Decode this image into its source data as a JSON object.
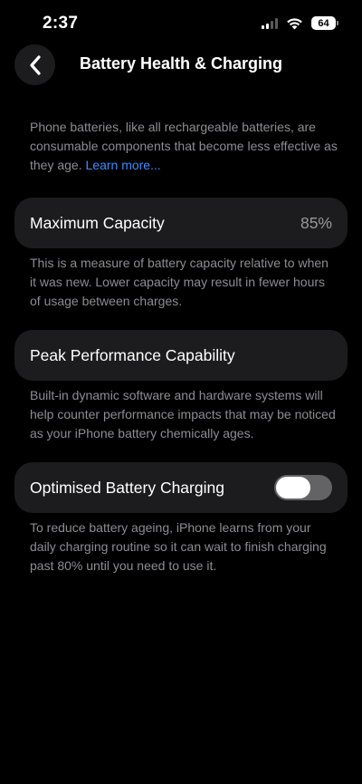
{
  "status_bar": {
    "time": "2:37",
    "battery_percent": "64",
    "signal_bars_active": 2,
    "icons": [
      "signal-icon",
      "wifi-icon",
      "battery-icon"
    ]
  },
  "header": {
    "back_icon": "chevron-left-icon",
    "title": "Battery Health & Charging"
  },
  "intro": {
    "text": "Phone batteries, like all rechargeable batteries, are consumable components that become less effective as they age.",
    "link": "Learn more..."
  },
  "max_capacity": {
    "label": "Maximum Capacity",
    "value": "85%",
    "footnote": "This is a measure of battery capacity relative to when it was new. Lower capacity may result in fewer hours of usage between charges."
  },
  "peak_performance": {
    "label": "Peak Performance Capability",
    "footnote": "Built-in dynamic software and hardware systems will help counter performance impacts that may be noticed as your iPhone battery chemically ages."
  },
  "optimised_charging": {
    "label": "Optimised Battery Charging",
    "enabled": false,
    "footnote": "To reduce battery ageing, iPhone learns from your daily charging routine so it can wait to finish charging past 80% until you need to use it."
  },
  "colors": {
    "background": "#000000",
    "cell": "#1c1c1e",
    "secondary_text": "#8d8d92",
    "link": "#3d8bff",
    "toggle_off": "#636366"
  }
}
